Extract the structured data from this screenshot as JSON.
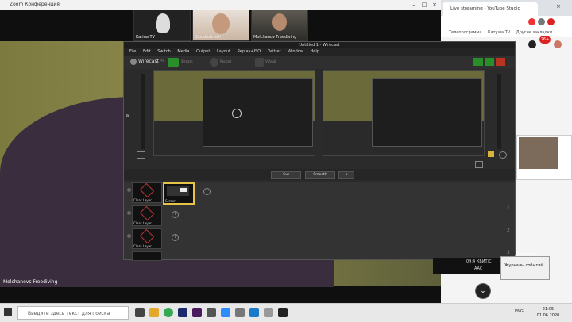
{
  "zoom": {
    "title": "Zoom Конференция",
    "participants": [
      "Karina.TV",
      "Bloodrobmsh",
      "Molchanov Freediving"
    ],
    "active_speaker": "Molchanovs Freediving"
  },
  "browser": {
    "tab_title": "Live streaming - YouTube Studio",
    "bookmarks": [
      "Телепрограмма",
      "Катуша.TV",
      "Другие закладки"
    ],
    "badge": "26+",
    "panel": {
      "row1": [
        "09:4 КБИТ/С",
        "Действия"
      ],
      "row2": [
        "AAC",
        "Журналы событий"
      ]
    }
  },
  "wirecast": {
    "title": "Untitled 1 - Wirecast",
    "menu": [
      "File",
      "Edit",
      "Switch",
      "Media",
      "Output",
      "Layout",
      "Replay+ISO",
      "Twitter",
      "Window",
      "Help"
    ],
    "toolbar_brand": "Wirecast",
    "toolbar_icon_labels": [
      "Pro",
      "Stream",
      "Record",
      "Virtual"
    ],
    "transitions": {
      "cut": "Cut",
      "smooth": "Smooth"
    },
    "layers": [
      {
        "label": "Clear Layer",
        "shot": "Screen"
      },
      {
        "label": "Clear Layer"
      },
      {
        "label": "Clear Layer"
      },
      {
        "label": ""
      }
    ],
    "layer_numbers": [
      "1",
      "2",
      "3"
    ]
  },
  "taskbar": {
    "search_placeholder": "Введите здесь текст для поиска",
    "language": "ENG",
    "time": "21:05",
    "date": "01.06.2020"
  },
  "colors": {
    "record_green": "#2a8f2a",
    "active_shot_border": "#e8c34a",
    "zoom_bg": "#0f0f0f"
  }
}
